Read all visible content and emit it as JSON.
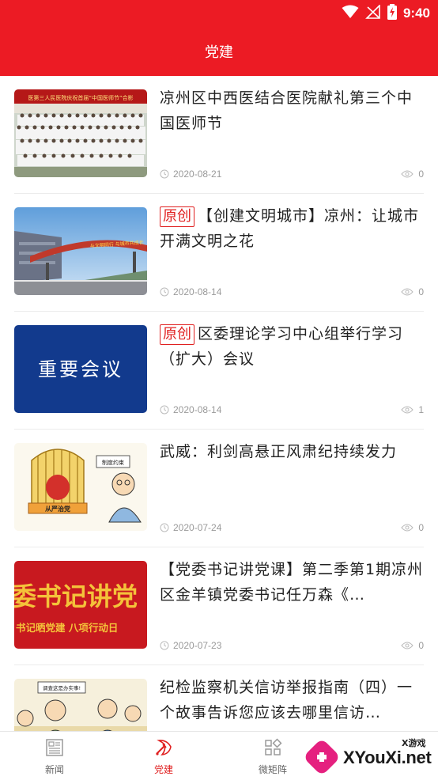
{
  "status_bar": {
    "time": "9:40"
  },
  "header": {
    "title": "党建"
  },
  "badge_label": "原创",
  "articles": [
    {
      "title": "凉州区中西医结合医院献礼第三个中国医师节",
      "original": false,
      "date": "2020-08-21",
      "views": "0",
      "thumb_text": [
        "医第三人民医院庆祝首届“中国医师节”合影"
      ]
    },
    {
      "title": "【创建文明城市】凉州：让城市开满文明之花",
      "original": true,
      "date": "2020-08-14",
      "views": "0",
      "thumb_text": [
        "与文明同行 与城市共成长"
      ]
    },
    {
      "title": "区委理论学习中心组举行学习（扩大）会议",
      "original": true,
      "date": "2020-08-14",
      "views": "1",
      "thumb_text": [
        "重要会议"
      ]
    },
    {
      "title": "武威：利剑高悬正风肃纪持续发力",
      "original": false,
      "date": "2020-07-24",
      "views": "0",
      "thumb_text": [
        "从严治党",
        "制度约束"
      ]
    },
    {
      "title": "【党委书记讲党课】第二季第1期凉州区金羊镇党委书记任万森《…",
      "original": false,
      "date": "2020-07-23",
      "views": "0",
      "thumb_text": [
        "委书记讲党",
        "书记晒党建  八项行动日"
      ]
    },
    {
      "title": "纪检监察机关信访举报指南（四）一个故事告诉您应该去哪里信访…",
      "original": false,
      "date": "",
      "views": "",
      "thumb_text": [
        "调查这是办实事!"
      ]
    }
  ],
  "bottom_nav": [
    {
      "label": "新闻",
      "icon": "newspaper-icon",
      "active": false
    },
    {
      "label": "党建",
      "icon": "party-emblem-icon",
      "active": true
    },
    {
      "label": "微矩阵",
      "icon": "grid-matrix-icon",
      "active": false
    }
  ],
  "watermark": {
    "small": "X游戏",
    "big": "XYouXi.net"
  },
  "colors": {
    "primary": "#ec1b24",
    "badge": "#e02020",
    "meta": "#9a9a9a"
  }
}
